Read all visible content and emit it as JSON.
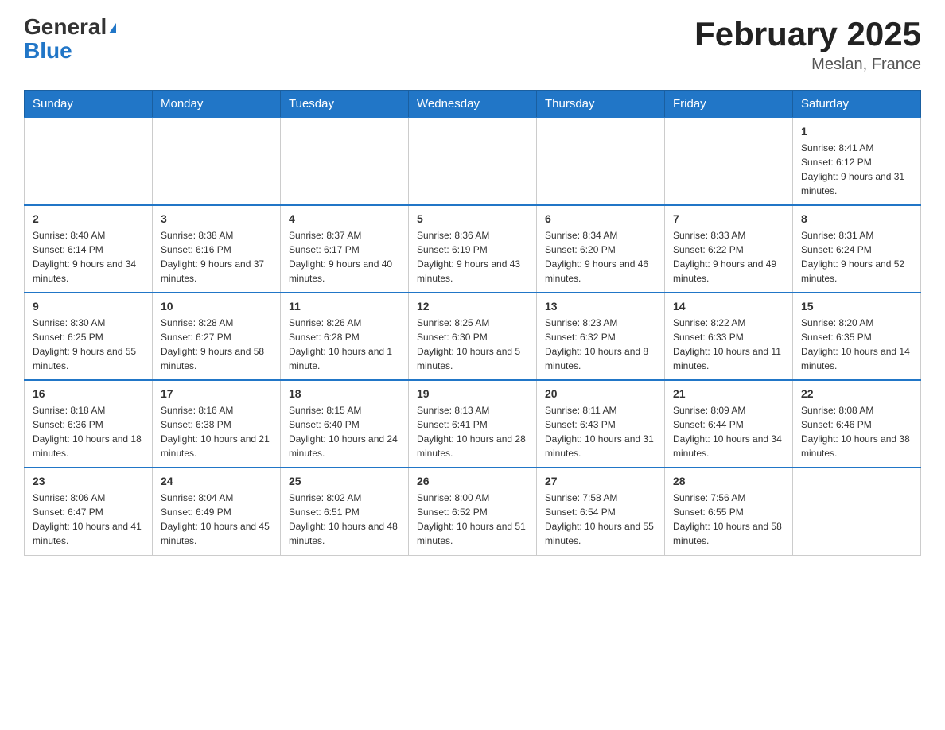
{
  "header": {
    "logo_general": "General",
    "logo_blue": "Blue",
    "title": "February 2025",
    "location": "Meslan, France"
  },
  "days_of_week": [
    "Sunday",
    "Monday",
    "Tuesday",
    "Wednesday",
    "Thursday",
    "Friday",
    "Saturday"
  ],
  "weeks": [
    {
      "days": [
        {
          "number": "",
          "info": ""
        },
        {
          "number": "",
          "info": ""
        },
        {
          "number": "",
          "info": ""
        },
        {
          "number": "",
          "info": ""
        },
        {
          "number": "",
          "info": ""
        },
        {
          "number": "",
          "info": ""
        },
        {
          "number": "1",
          "info": "Sunrise: 8:41 AM\nSunset: 6:12 PM\nDaylight: 9 hours and 31 minutes."
        }
      ]
    },
    {
      "days": [
        {
          "number": "2",
          "info": "Sunrise: 8:40 AM\nSunset: 6:14 PM\nDaylight: 9 hours and 34 minutes."
        },
        {
          "number": "3",
          "info": "Sunrise: 8:38 AM\nSunset: 6:16 PM\nDaylight: 9 hours and 37 minutes."
        },
        {
          "number": "4",
          "info": "Sunrise: 8:37 AM\nSunset: 6:17 PM\nDaylight: 9 hours and 40 minutes."
        },
        {
          "number": "5",
          "info": "Sunrise: 8:36 AM\nSunset: 6:19 PM\nDaylight: 9 hours and 43 minutes."
        },
        {
          "number": "6",
          "info": "Sunrise: 8:34 AM\nSunset: 6:20 PM\nDaylight: 9 hours and 46 minutes."
        },
        {
          "number": "7",
          "info": "Sunrise: 8:33 AM\nSunset: 6:22 PM\nDaylight: 9 hours and 49 minutes."
        },
        {
          "number": "8",
          "info": "Sunrise: 8:31 AM\nSunset: 6:24 PM\nDaylight: 9 hours and 52 minutes."
        }
      ]
    },
    {
      "days": [
        {
          "number": "9",
          "info": "Sunrise: 8:30 AM\nSunset: 6:25 PM\nDaylight: 9 hours and 55 minutes."
        },
        {
          "number": "10",
          "info": "Sunrise: 8:28 AM\nSunset: 6:27 PM\nDaylight: 9 hours and 58 minutes."
        },
        {
          "number": "11",
          "info": "Sunrise: 8:26 AM\nSunset: 6:28 PM\nDaylight: 10 hours and 1 minute."
        },
        {
          "number": "12",
          "info": "Sunrise: 8:25 AM\nSunset: 6:30 PM\nDaylight: 10 hours and 5 minutes."
        },
        {
          "number": "13",
          "info": "Sunrise: 8:23 AM\nSunset: 6:32 PM\nDaylight: 10 hours and 8 minutes."
        },
        {
          "number": "14",
          "info": "Sunrise: 8:22 AM\nSunset: 6:33 PM\nDaylight: 10 hours and 11 minutes."
        },
        {
          "number": "15",
          "info": "Sunrise: 8:20 AM\nSunset: 6:35 PM\nDaylight: 10 hours and 14 minutes."
        }
      ]
    },
    {
      "days": [
        {
          "number": "16",
          "info": "Sunrise: 8:18 AM\nSunset: 6:36 PM\nDaylight: 10 hours and 18 minutes."
        },
        {
          "number": "17",
          "info": "Sunrise: 8:16 AM\nSunset: 6:38 PM\nDaylight: 10 hours and 21 minutes."
        },
        {
          "number": "18",
          "info": "Sunrise: 8:15 AM\nSunset: 6:40 PM\nDaylight: 10 hours and 24 minutes."
        },
        {
          "number": "19",
          "info": "Sunrise: 8:13 AM\nSunset: 6:41 PM\nDaylight: 10 hours and 28 minutes."
        },
        {
          "number": "20",
          "info": "Sunrise: 8:11 AM\nSunset: 6:43 PM\nDaylight: 10 hours and 31 minutes."
        },
        {
          "number": "21",
          "info": "Sunrise: 8:09 AM\nSunset: 6:44 PM\nDaylight: 10 hours and 34 minutes."
        },
        {
          "number": "22",
          "info": "Sunrise: 8:08 AM\nSunset: 6:46 PM\nDaylight: 10 hours and 38 minutes."
        }
      ]
    },
    {
      "days": [
        {
          "number": "23",
          "info": "Sunrise: 8:06 AM\nSunset: 6:47 PM\nDaylight: 10 hours and 41 minutes."
        },
        {
          "number": "24",
          "info": "Sunrise: 8:04 AM\nSunset: 6:49 PM\nDaylight: 10 hours and 45 minutes."
        },
        {
          "number": "25",
          "info": "Sunrise: 8:02 AM\nSunset: 6:51 PM\nDaylight: 10 hours and 48 minutes."
        },
        {
          "number": "26",
          "info": "Sunrise: 8:00 AM\nSunset: 6:52 PM\nDaylight: 10 hours and 51 minutes."
        },
        {
          "number": "27",
          "info": "Sunrise: 7:58 AM\nSunset: 6:54 PM\nDaylight: 10 hours and 55 minutes."
        },
        {
          "number": "28",
          "info": "Sunrise: 7:56 AM\nSunset: 6:55 PM\nDaylight: 10 hours and 58 minutes."
        },
        {
          "number": "",
          "info": ""
        }
      ]
    }
  ]
}
